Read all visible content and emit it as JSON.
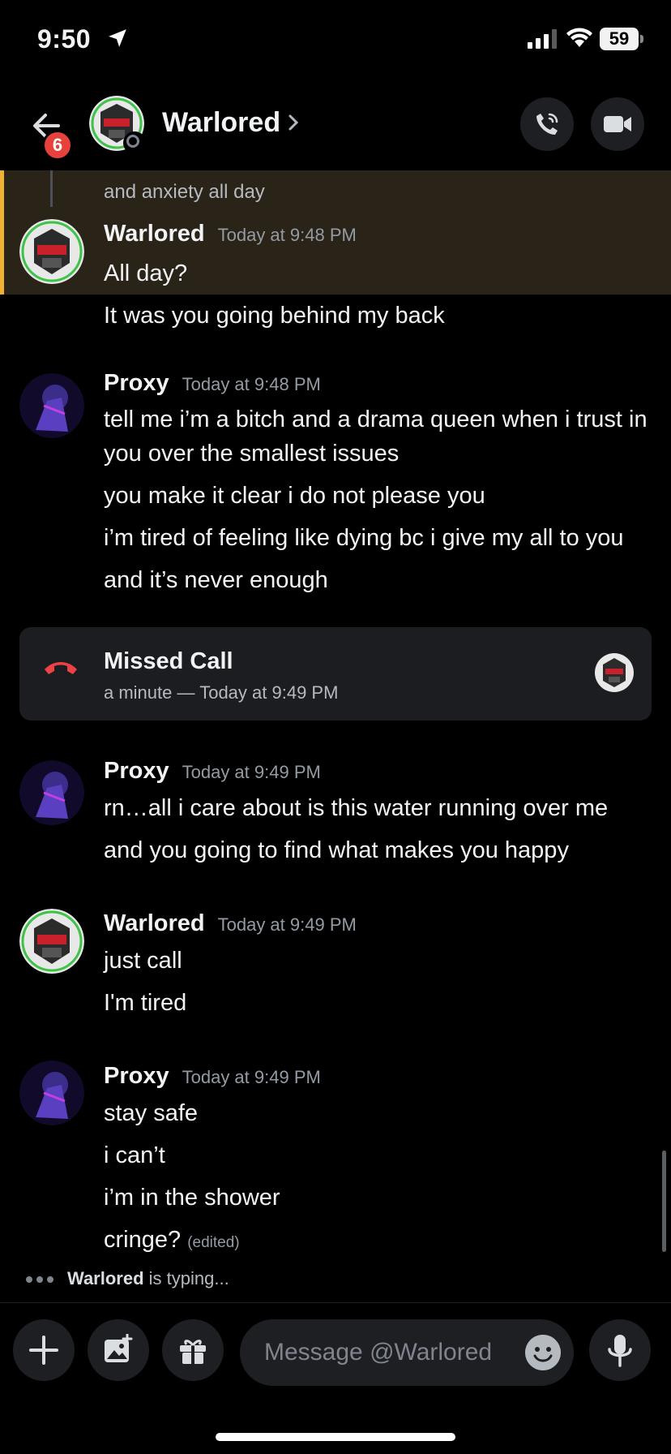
{
  "status_bar": {
    "time": "9:50",
    "battery": "59"
  },
  "header": {
    "badge_count": "6",
    "contact_name": "Warlored"
  },
  "reply_preview": {
    "text": "and anxiety all day"
  },
  "messages": [
    {
      "author": "Warlored",
      "timestamp": "Today at 9:48 PM",
      "lines": [
        "All day?",
        "It was you going behind my back"
      ]
    },
    {
      "author": "Proxy",
      "timestamp": "Today at 9:48 PM",
      "lines": [
        "tell me i’m a bitch and a drama queen when i trust in you over the smallest issues",
        "you make it clear i do not please you",
        "i’m tired of feeling like dying bc i give my all to you",
        "and it’s never enough"
      ]
    },
    {
      "author": "Proxy",
      "timestamp": "Today at 9:49 PM",
      "lines": [
        "rn…all i care about is this water running over me",
        "and you going to find what makes you happy"
      ]
    },
    {
      "author": "Warlored",
      "timestamp": "Today at 9:49 PM",
      "lines": [
        "just call",
        "I'm tired"
      ]
    },
    {
      "author": "Proxy",
      "timestamp": "Today at 9:49 PM",
      "lines": [
        "stay safe",
        "i can’t",
        "i’m in the shower",
        "cringe?"
      ],
      "edited_label": "(edited)"
    }
  ],
  "missed_call": {
    "title": "Missed Call",
    "subtitle": "a minute — Today at 9:49 PM"
  },
  "typing": {
    "user": "Warlored",
    "suffix": "is typing..."
  },
  "composer": {
    "placeholder": "Message @Warlored"
  },
  "icons": {
    "back": "arrow-left-icon",
    "call": "phone-call-icon",
    "video": "video-camera-icon",
    "add": "plus-icon",
    "gallery": "image-icon",
    "gift": "gift-icon",
    "emoji": "emoji-icon",
    "mic": "microphone-icon",
    "missed_call": "phone-hangup-icon"
  },
  "colors": {
    "background": "#000000",
    "highlight": "#2a2317",
    "highlight_bar": "#f0b132",
    "badge": "#e7413c",
    "missed_call_icon": "#ed4245"
  }
}
